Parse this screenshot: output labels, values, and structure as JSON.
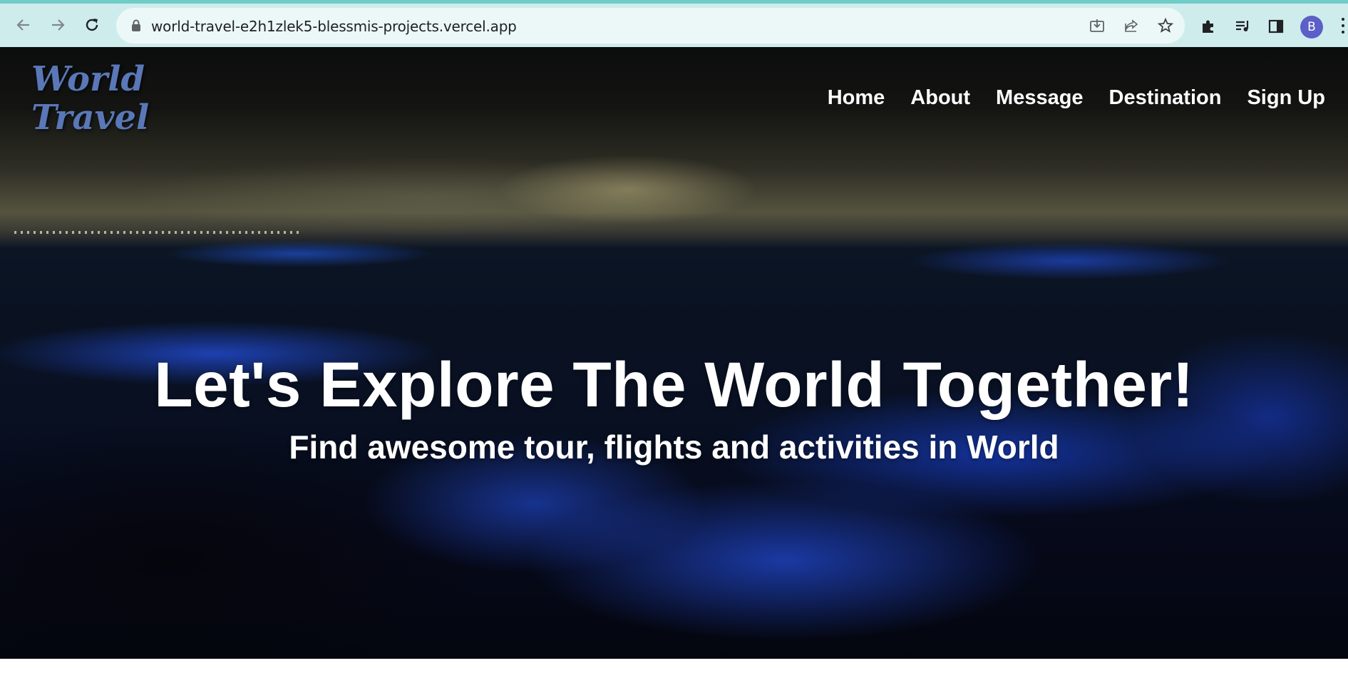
{
  "browser": {
    "url": "world-travel-e2h1zlek5-blessmis-projects.vercel.app",
    "profile_initial": "B",
    "icons": {
      "back": "back-arrow-icon",
      "forward": "forward-arrow-icon",
      "reload": "reload-icon",
      "lock": "lock-icon",
      "install": "install-app-icon",
      "share": "share-icon",
      "bookmark": "star-icon",
      "extensions": "puzzle-icon",
      "media": "media-queue-icon",
      "side_panel": "side-panel-icon",
      "menu": "kebab-menu-icon"
    }
  },
  "site": {
    "logo_line1": "World",
    "logo_line2": "Travel",
    "nav": [
      {
        "label": "Home"
      },
      {
        "label": "About"
      },
      {
        "label": "Message"
      },
      {
        "label": "Destination"
      },
      {
        "label": "Sign Up"
      }
    ]
  },
  "hero": {
    "title": "Let's Explore The World Together!",
    "subtitle": "Find awesome tour, flights and activities in World"
  },
  "colors": {
    "chrome_bg": "#cfeced",
    "omnibox_bg": "#ecf8f8",
    "logo": "#5a78b8",
    "avatar": "#5b5fc7",
    "bioluminescence": "#285aff"
  }
}
